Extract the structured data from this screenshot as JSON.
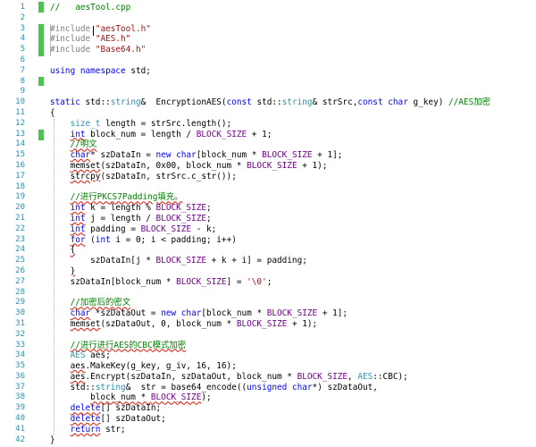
{
  "editor": {
    "lines": [
      {
        "n": "1",
        "html": "<span class=\"cm\">//   aesTool.cpp</span>"
      },
      {
        "n": "2",
        "html": ""
      },
      {
        "n": "3",
        "html": "<span class=\"pp\">#include</span> <span class=\"st\">\"aesTool.h\"</span>"
      },
      {
        "n": "4",
        "html": "<span class=\"pp\">#include</span> <span class=\"st\">\"AES.h\"</span>"
      },
      {
        "n": "5",
        "html": "<span class=\"pp\">#include</span> <span class=\"st\">\"Base64.h\"</span>"
      },
      {
        "n": "6",
        "html": ""
      },
      {
        "n": "7",
        "html": "<span class=\"kw\">using namespace</span> std;"
      },
      {
        "n": "8",
        "html": ""
      },
      {
        "n": "9",
        "html": ""
      },
      {
        "n": "10",
        "html": "<span class=\"kw\">static</span> std::<span class=\"ty\">string</span>&  EncryptionAES(<span class=\"kw\">const</span> std::<span class=\"ty\">string</span>& strSrc,<span class=\"kw\">const</span> <span class=\"kw\">char</span> g_key) <span class=\"cm\">//AES加密</span>"
      },
      {
        "n": "11",
        "html": "{"
      },
      {
        "n": "12",
        "html": "    <span class=\"ty\">size_t</span> length = strSrc.length();"
      },
      {
        "n": "13",
        "html": "    <span class=\"kw sq\">int</span> block_num = length / <span class=\"mc\">BLOCK_SIZE</span> + 1;"
      },
      {
        "n": "14",
        "html": "    <span class=\"cm sq\">//明文</span>"
      },
      {
        "n": "15",
        "html": "    <span class=\"kw sq\">char</span>* szDataIn = <span class=\"kw\">new</span> <span class=\"kw\">char</span>[block_num * <span class=\"mc\">BLOCK_SIZE</span> + 1];"
      },
      {
        "n": "16",
        "html": "    <span class=\"sq\">memset</span>(szDataIn, 0x00, block_num * <span class=\"mc\">BLOCK_SIZE</span> + 1);"
      },
      {
        "n": "17",
        "html": "    <span class=\"sq\">strcpy</span>(szDataIn, strSrc.c_str());"
      },
      {
        "n": "18",
        "html": ""
      },
      {
        "n": "19",
        "html": "    <span class=\"cm sq\">//进行PKCS7Padding填充。</span>"
      },
      {
        "n": "20",
        "html": "    <span class=\"kw sq\">int</span> k = length % <span class=\"mc\">BLOCK_SIZE</span>;"
      },
      {
        "n": "21",
        "html": "    <span class=\"kw sq\">int</span> j = length / <span class=\"mc\">BLOCK_SIZE</span>;"
      },
      {
        "n": "22",
        "html": "    <span class=\"kw sq\">int</span> padding = <span class=\"mc\">BLOCK_SIZE</span> - k;"
      },
      {
        "n": "23",
        "html": "    <span class=\"kw sq\">for</span> (<span class=\"kw\">int</span> i = 0; i &lt; padding; i++)"
      },
      {
        "n": "24",
        "html": "    <span class=\"sq\">{</span>"
      },
      {
        "n": "25",
        "html": "        szDataIn[j * <span class=\"mc\">BLOCK_SIZE</span> + k + i] = padding;"
      },
      {
        "n": "26",
        "html": "    <span class=\"sq\">}</span>"
      },
      {
        "n": "27",
        "html": "    szDataIn[block_num * <span class=\"mc\">BLOCK_SIZE</span>] = <span class=\"st\">'\\0'</span>;"
      },
      {
        "n": "28",
        "html": ""
      },
      {
        "n": "29",
        "html": "    <span class=\"cm sq\">//加密后的密文</span>"
      },
      {
        "n": "30",
        "html": "    <span class=\"kw sq\">char</span> *szDataOut = <span class=\"kw\">new</span> <span class=\"kw\">char</span>[block_num * <span class=\"mc\">BLOCK_SIZE</span> + 1];"
      },
      {
        "n": "31",
        "html": "    <span class=\"sq\">memset</span>(szDataOut, 0, block_num * <span class=\"mc\">BLOCK_SIZE</span> + 1);"
      },
      {
        "n": "32",
        "html": ""
      },
      {
        "n": "33",
        "html": "    <span class=\"cm sq\">//进行进行AES的CBC模式加密</span>"
      },
      {
        "n": "34",
        "html": "    <span class=\"ty\">AES</span> aes;"
      },
      {
        "n": "35",
        "html": "    <span class=\"sq\">aes</span>.MakeKey(g_key, g_iv, 16, 16);"
      },
      {
        "n": "36",
        "html": "    <span class=\"sq\">aes</span>.Encrypt(szDataIn, szDataOut, block_num * <span class=\"mc\">BLOCK_SIZE</span>, <span class=\"ty\">AES</span>::CBC);"
      },
      {
        "n": "37",
        "html": "    std::<span class=\"ty\">string</span>&  str = base64_encode((<span class=\"kw\">unsigned</span> <span class=\"kw\">char</span>*) szDataOut,"
      },
      {
        "n": "38",
        "html": "        <span class=\"sq\">block_num * </span><span class=\"mc sq\">BLOCK_SIZE</span>);"
      },
      {
        "n": "39",
        "html": "    <span class=\"kw sq\">delete</span>[] szDataIn;"
      },
      {
        "n": "40",
        "html": "    <span class=\"kw sq\">delete</span>[] szDataOut;"
      },
      {
        "n": "41",
        "html": "    <span class=\"kw sq\">return</span> str;"
      },
      {
        "n": "42",
        "html": "}"
      }
    ]
  },
  "colors": {
    "line_number": "#2b91af",
    "keyword": "#0000ff",
    "comment": "#008000",
    "string": "#a31515",
    "type": "#2b91af",
    "macro": "#6f008a",
    "change_bar": "#4ec24e",
    "squiggle": "#e51400"
  }
}
